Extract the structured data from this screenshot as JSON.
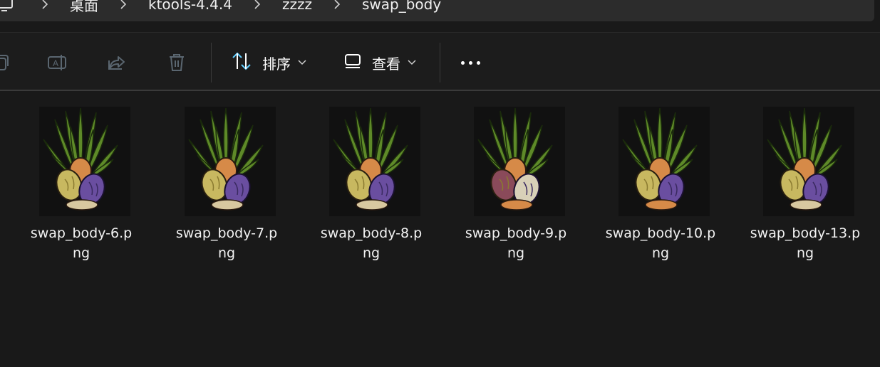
{
  "breadcrumb": {
    "items": [
      "桌面",
      "ktools-4.4.4",
      "zzzz",
      "swap_body"
    ]
  },
  "toolbar": {
    "icons": [
      "copy-icon",
      "rename-icon",
      "share-icon",
      "delete-icon"
    ],
    "sort_label": "排序",
    "view_label": "查看"
  },
  "files": [
    {
      "name_line1": "swap_body-6.p",
      "name_line2": "ng",
      "variant": "a"
    },
    {
      "name_line1": "swap_body-7.p",
      "name_line2": "ng",
      "variant": "a"
    },
    {
      "name_line1": "swap_body-8.p",
      "name_line2": "ng",
      "variant": "b"
    },
    {
      "name_line1": "swap_body-9.p",
      "name_line2": "ng",
      "variant": "c"
    },
    {
      "name_line1": "swap_body-10.p",
      "name_line2": "ng",
      "variant": "d"
    },
    {
      "name_line1": "swap_body-13.p",
      "name_line2": "ng",
      "variant": "a"
    }
  ],
  "colors": {
    "background": "#191919",
    "toolbar": "#1c1c1c",
    "address_bar": "#2c2c2c",
    "accent_sort_icon": "#60cdff"
  }
}
